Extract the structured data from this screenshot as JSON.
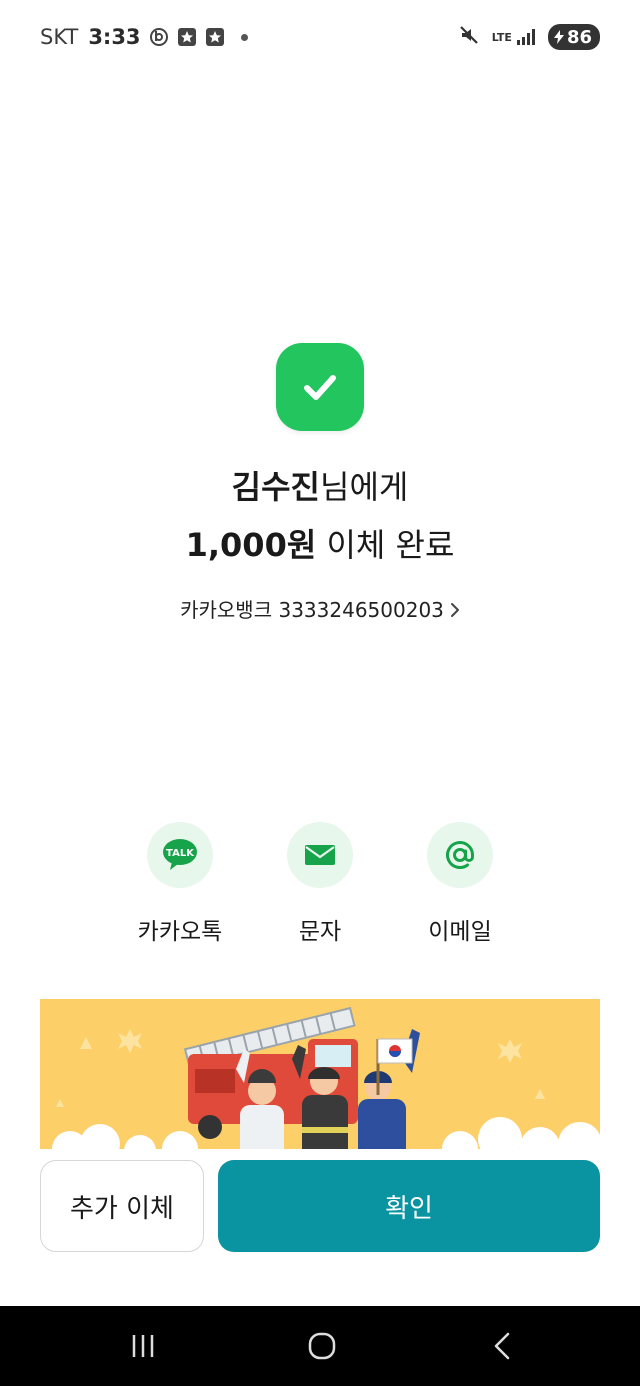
{
  "status_bar": {
    "carrier": "SKT",
    "time": "3:33",
    "network": "LTE",
    "battery": "86"
  },
  "result": {
    "recipient_name": "김수진",
    "recipient_suffix": "님에게",
    "amount": "1,000원",
    "amount_suffix": " 이체 완료",
    "account_bank": "카카오뱅크",
    "account_number": "3333246500203"
  },
  "share": [
    {
      "label": "카카오톡",
      "icon": "kakaotalk-icon",
      "icon_text": "TALK"
    },
    {
      "label": "문자",
      "icon": "message-icon"
    },
    {
      "label": "이메일",
      "icon": "email-at-icon"
    }
  ],
  "buttons": {
    "secondary": "추가 이체",
    "primary": "확인"
  },
  "colors": {
    "success": "#22c55e",
    "primary_button": "#0a94a2",
    "share_bg": "#e7f7ec",
    "share_icon": "#16a34a",
    "banner_bg": "#fccf69"
  }
}
